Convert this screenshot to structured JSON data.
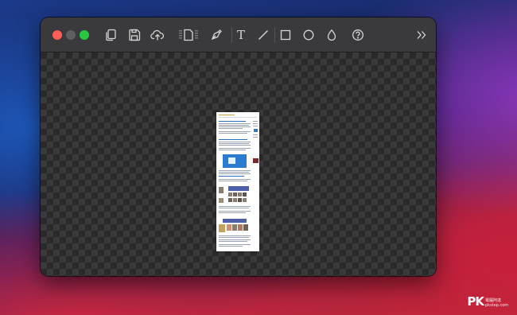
{
  "toolbar": {
    "tools": [
      {
        "name": "copy-icon"
      },
      {
        "name": "save-icon"
      },
      {
        "name": "cloud-upload-icon"
      },
      {
        "name": "crop-icon"
      },
      {
        "name": "pen-icon"
      },
      {
        "name": "text-icon",
        "glyph": "T"
      },
      {
        "name": "line-icon"
      },
      {
        "name": "rectangle-icon"
      },
      {
        "name": "circle-icon"
      },
      {
        "name": "drop-icon"
      },
      {
        "name": "help-icon"
      },
      {
        "name": "expand-icon"
      }
    ]
  },
  "colors": {
    "close": "#ff5f57",
    "minimize": "#5f5f63",
    "maximize": "#28c840",
    "toolbar": "#3a3a3c",
    "icon": "#d6d6d6"
  },
  "watermark": {
    "logo": "PK",
    "text": "電腦阿達 pkstep.com"
  }
}
